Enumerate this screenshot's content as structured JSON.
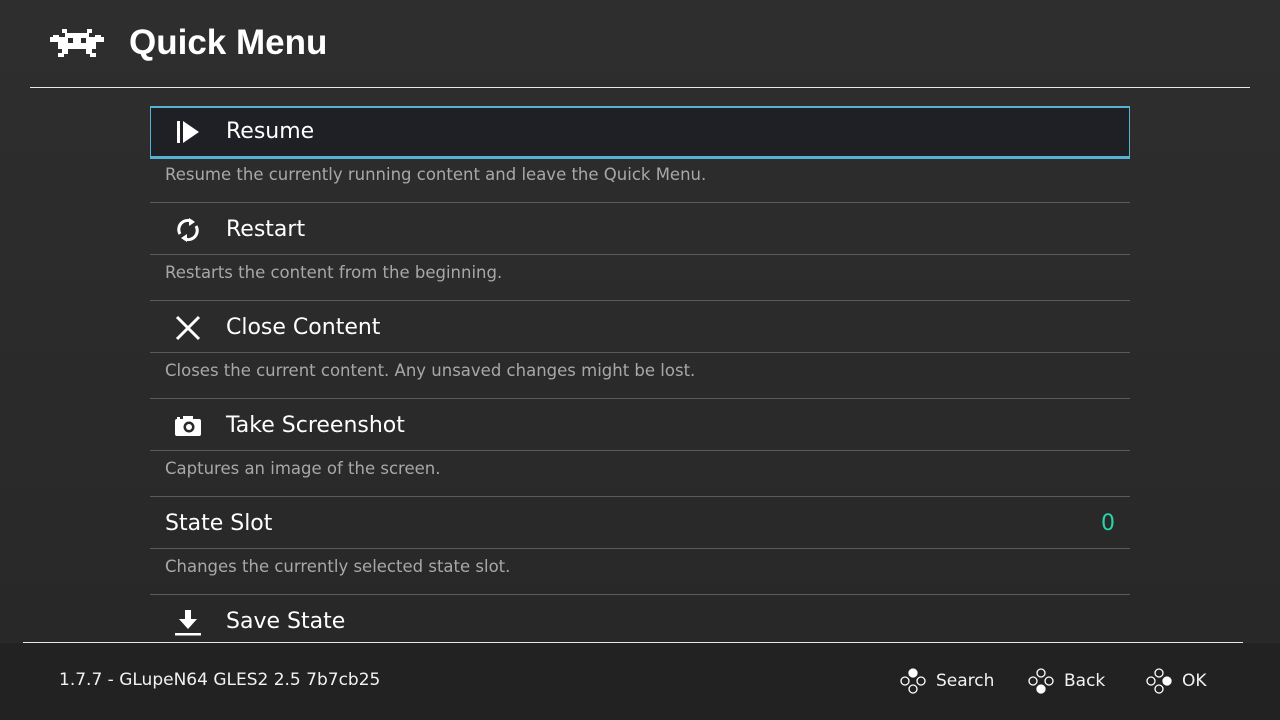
{
  "header": {
    "logo_icon": "retroarch-invader-icon",
    "title": "Quick Menu"
  },
  "menu": {
    "entries": [
      {
        "label": "Resume",
        "icon": "resume-icon",
        "description": "Resume the currently running content and leave the Quick Menu.",
        "selected": true
      },
      {
        "label": "Restart",
        "icon": "restart-icon",
        "description": "Restarts the content from the beginning."
      },
      {
        "label": "Close Content",
        "icon": "close-icon",
        "description": "Closes the current content. Any unsaved changes might be lost."
      },
      {
        "label": "Take Screenshot",
        "icon": "camera-icon",
        "description": "Captures an image of the screen."
      },
      {
        "label": "State Slot",
        "value": "0",
        "description": "Changes the currently selected state slot."
      },
      {
        "label": "Save State",
        "icon": "save-state-icon"
      }
    ]
  },
  "footer": {
    "version": "1.7.7 - GLupeN64 GLES2 2.5 7b7cb25",
    "buttons": [
      {
        "label": "Search",
        "icon": "gamepad-top-button-icon"
      },
      {
        "label": "Back",
        "icon": "gamepad-bottom-button-icon"
      },
      {
        "label": "OK",
        "icon": "gamepad-right-button-icon"
      }
    ]
  },
  "colors": {
    "selection_border": "#55b2d2",
    "value_accent": "#27d5a9"
  }
}
